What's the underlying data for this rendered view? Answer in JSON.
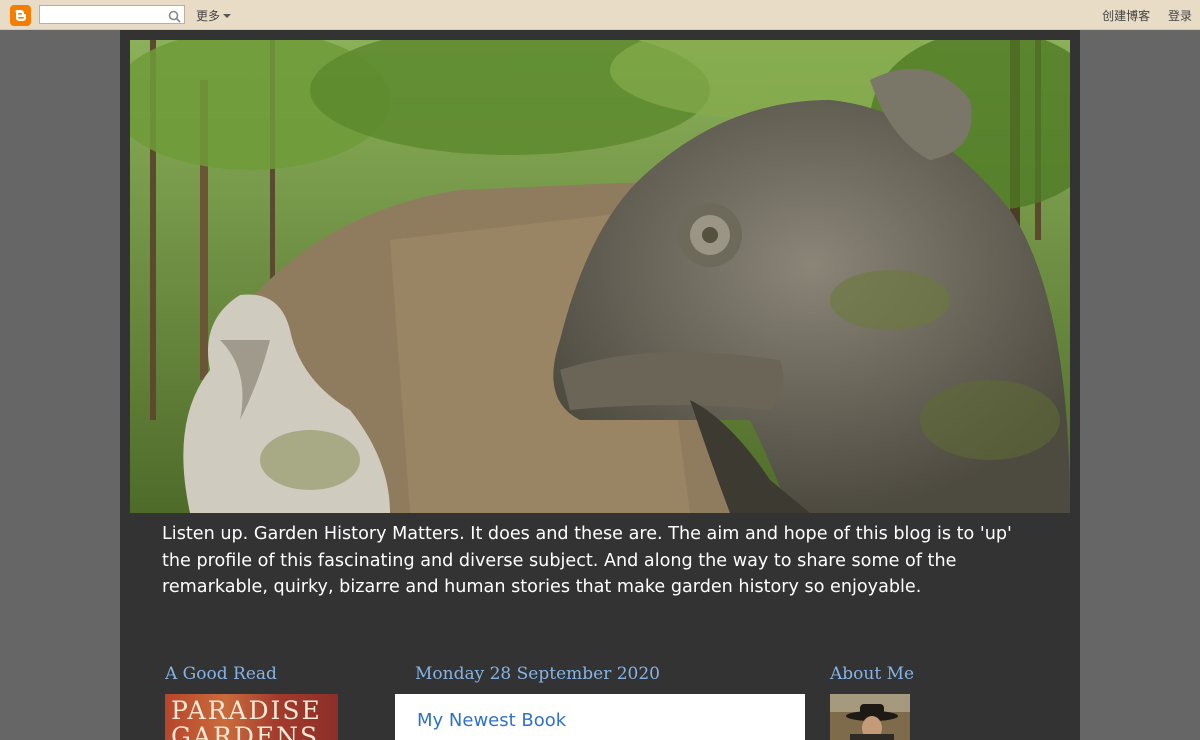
{
  "navbar": {
    "search_placeholder": "",
    "more_label": "更多",
    "create_blog_label": "创建博客",
    "sign_in_label": "登录"
  },
  "header": {
    "description": "Listen up. Garden History Matters. It does and these are. The aim and hope of this blog is to 'up' the profile of this fascinating and diverse subject. And along the way to share some of the remarkable, quirky, bizarre and human stories that make garden history so enjoyable."
  },
  "sidebar_left": {
    "title": "A Good Read",
    "book_cover_text": "PARADISE\nGARDENS"
  },
  "main": {
    "date": "Monday 28 September 2020",
    "post_title": "My Newest Book"
  },
  "sidebar_right": {
    "title": "About Me"
  },
  "colors": {
    "navbar_bg": "#e9dcc6",
    "page_bg": "#666666",
    "content_bg": "#333333",
    "heading_blue": "#85b4e6",
    "link_blue": "#2e72c8",
    "blogger_orange": "#f57d00"
  }
}
